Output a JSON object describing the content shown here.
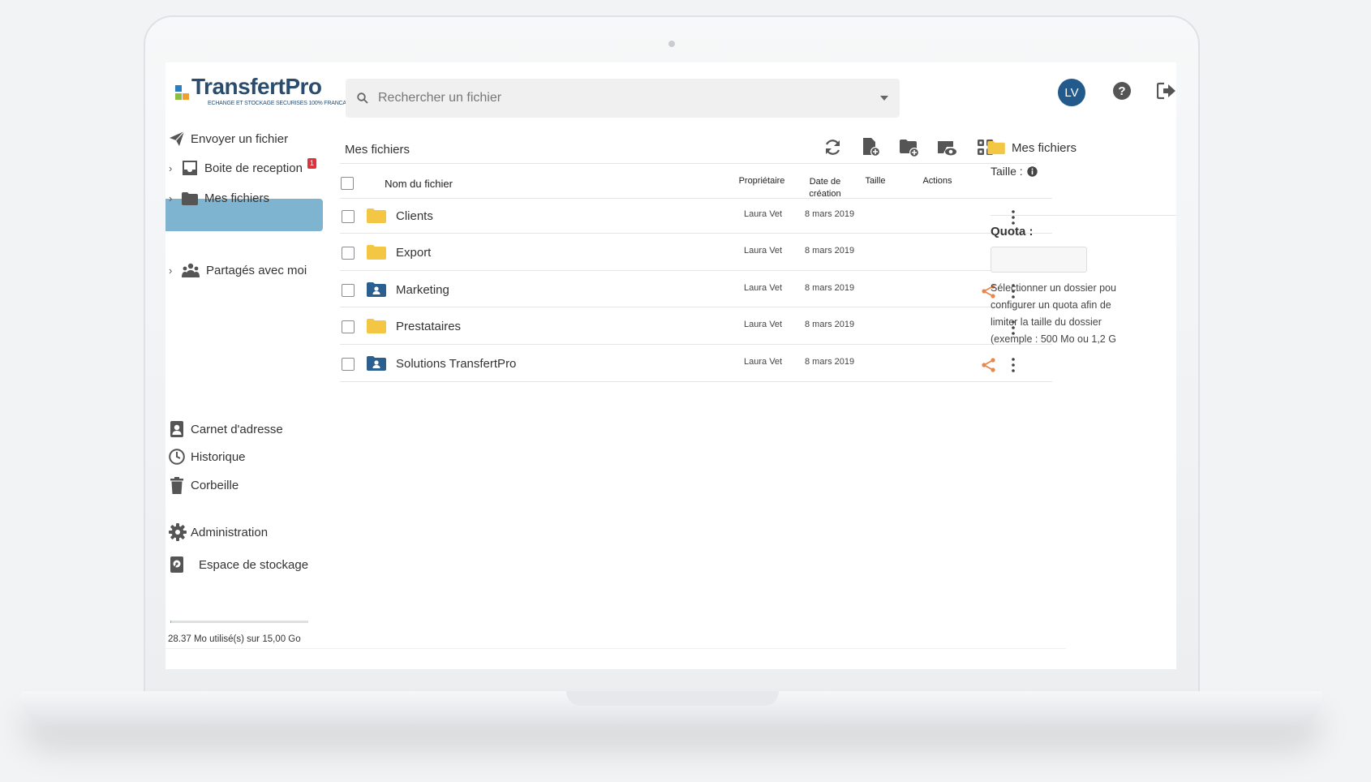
{
  "brand": {
    "title": "TransfertPro",
    "tagline": "ECHANGE ET STOCKAGE SECURISES 100% FRANCAIS"
  },
  "search": {
    "placeholder": "Rechercher un fichier"
  },
  "user": {
    "initials": "LV"
  },
  "sidebar": {
    "items": [
      {
        "label": "Envoyer un fichier",
        "icon": "send-icon"
      },
      {
        "label": "Boite de reception",
        "icon": "inbox-icon",
        "badge": "1"
      },
      {
        "label": "Mes fichiers",
        "icon": "folder-icon",
        "active": true
      },
      {
        "label": "Partagés avec moi",
        "icon": "users-icon"
      },
      {
        "label": "Carnet d'adresse",
        "icon": "contacts-icon"
      },
      {
        "label": "Historique",
        "icon": "clock-icon"
      },
      {
        "label": "Corbeille",
        "icon": "trash-icon"
      },
      {
        "label": "Administration",
        "icon": "gear-icon"
      },
      {
        "label": "Espace de stockage",
        "icon": "storage-icon"
      }
    ],
    "storage_text": "28.37 Mo utilisé(s) sur 15,00 Go",
    "storage_fraction": 0.0018
  },
  "main": {
    "title": "Mes fichiers",
    "columns": {
      "name": "Nom du fichier",
      "owner": "Propriétaire",
      "date_line1": "Date de",
      "date_line2": "création",
      "size": "Taille",
      "actions": "Actions"
    },
    "rows": [
      {
        "name": "Clients",
        "owner": "Laura Vet",
        "date": "8 mars 2019",
        "type": "folder",
        "shared": false
      },
      {
        "name": "Export",
        "owner": "Laura Vet",
        "date": "8 mars 2019",
        "type": "folder",
        "shared": false
      },
      {
        "name": "Marketing",
        "owner": "Laura Vet",
        "date": "8 mars 2019",
        "type": "shared-folder",
        "shared": true
      },
      {
        "name": "Prestataires",
        "owner": "Laura Vet",
        "date": "8 mars 2019",
        "type": "folder",
        "shared": false
      },
      {
        "name": "Solutions TransfertPro",
        "owner": "Laura Vet",
        "date": "8 mars 2019",
        "type": "shared-folder",
        "shared": true
      }
    ]
  },
  "details": {
    "folder": "Mes fichiers",
    "size_label": "Taille :",
    "quota_label": "Quota :",
    "help_lines": [
      "Sélectionner un dossier pou",
      "configurer un quota afin de",
      "limiter la taille du dossier",
      "(exemple : 500 Mo ou 1,2 G"
    ]
  },
  "colors": {
    "accent": "#7eb4cf",
    "brand": "#2a4d6e",
    "avatar": "#235a8c",
    "folder": "#f3c744",
    "shared_folder": "#2b5f8f",
    "share": "#e8874c",
    "badge": "#e0323c"
  }
}
